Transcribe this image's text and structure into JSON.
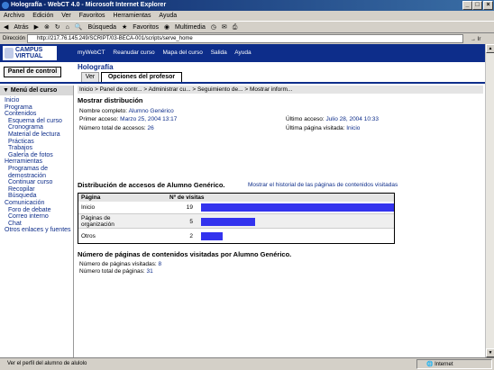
{
  "window": {
    "title": "Holografía - WebCT 4.0 - Microsoft Internet Explorer"
  },
  "menu": [
    "Archivo",
    "Edición",
    "Ver",
    "Favoritos",
    "Herramientas",
    "Ayuda"
  ],
  "toolbar": {
    "back": "Atrás",
    "search": "Búsqueda",
    "favorites": "Favoritos",
    "multimedia": "Multimedia"
  },
  "address": {
    "label": "Dirección",
    "url": "http://217.76.145.249/SCRIPT/03-BECA-001/scripts/serve_home",
    "go": "Ir"
  },
  "webct": {
    "logo_line1": "CAMPUS",
    "logo_line2": "VIRTUAL",
    "nav": [
      "myWebCT",
      "Reanudar curso",
      "Mapa del curso",
      "Salida",
      "Ayuda"
    ]
  },
  "course": {
    "panel_button": "Panel de control",
    "title": "Holografía",
    "tab_view": "Ver",
    "tab_options": "Opciones del profesor"
  },
  "sidebar": {
    "header": "Menú del curso",
    "items": [
      {
        "label": "Inicio",
        "level": 0
      },
      {
        "label": "Programa",
        "level": 0
      },
      {
        "label": "Contenidos",
        "level": 0
      },
      {
        "label": "Esquema del curso",
        "level": 1
      },
      {
        "label": "Cronograma",
        "level": 1
      },
      {
        "label": "Material de lectura",
        "level": 1
      },
      {
        "label": "Prácticas",
        "level": 1
      },
      {
        "label": "Trabajos",
        "level": 1
      },
      {
        "label": "Galería de fotos",
        "level": 1
      },
      {
        "label": "Herramientas",
        "level": 0
      },
      {
        "label": "Programas de demostración",
        "level": 1
      },
      {
        "label": "Continuar curso",
        "level": 1
      },
      {
        "label": "Recopilar",
        "level": 1
      },
      {
        "label": "Búsqueda",
        "level": 1
      },
      {
        "label": "Comunicación",
        "level": 0
      },
      {
        "label": "Foro de debate",
        "level": 1
      },
      {
        "label": "Correo interno",
        "level": 1
      },
      {
        "label": "Chat",
        "level": 1
      },
      {
        "label": "Otros enlaces y fuentes",
        "level": 0
      }
    ]
  },
  "breadcrumb": "Inicio > Panel de contr... > Administrar cu... > Seguimiento de... > Mostrar inform...",
  "details": {
    "heading": "Mostrar distribución",
    "full_name_label": "Nombre completo:",
    "full_name": "Alumno Genérico",
    "first_access_label": "Primer acceso:",
    "first_access": "Marzo 25, 2004 13:17",
    "total_access_label": "Número total de accesos:",
    "total_access": "26",
    "last_access_label": "Último acceso:",
    "last_access": "Julio 28, 2004 10:33",
    "last_page_label": "Última página visitada:",
    "last_page": "Inicio"
  },
  "distribution": {
    "heading": "Distribución de accesos de Alumno Genérico.",
    "history_link": "Mostrar el historial de las páginas de contenidos visitadas",
    "col_page": "Página",
    "col_visits": "Nº de visitas",
    "rows": [
      {
        "page": "Inicio",
        "visits": "19",
        "share": 1.0
      },
      {
        "page": "Páginas de organización",
        "visits": "5",
        "share": 0.28
      },
      {
        "page": "Otros",
        "visits": "2",
        "share": 0.11
      }
    ],
    "bar_color": "#3333ee"
  },
  "content_pages": {
    "heading": "Número de páginas de contenidos visitadas por Alumno Genérico.",
    "visited_label": "Número de páginas visitadas:",
    "visited": "8",
    "total_label": "Número total de páginas:",
    "total": "31"
  },
  "status": {
    "text": "Ver el perfil del alumno de alulolo",
    "zone": "Internet"
  }
}
